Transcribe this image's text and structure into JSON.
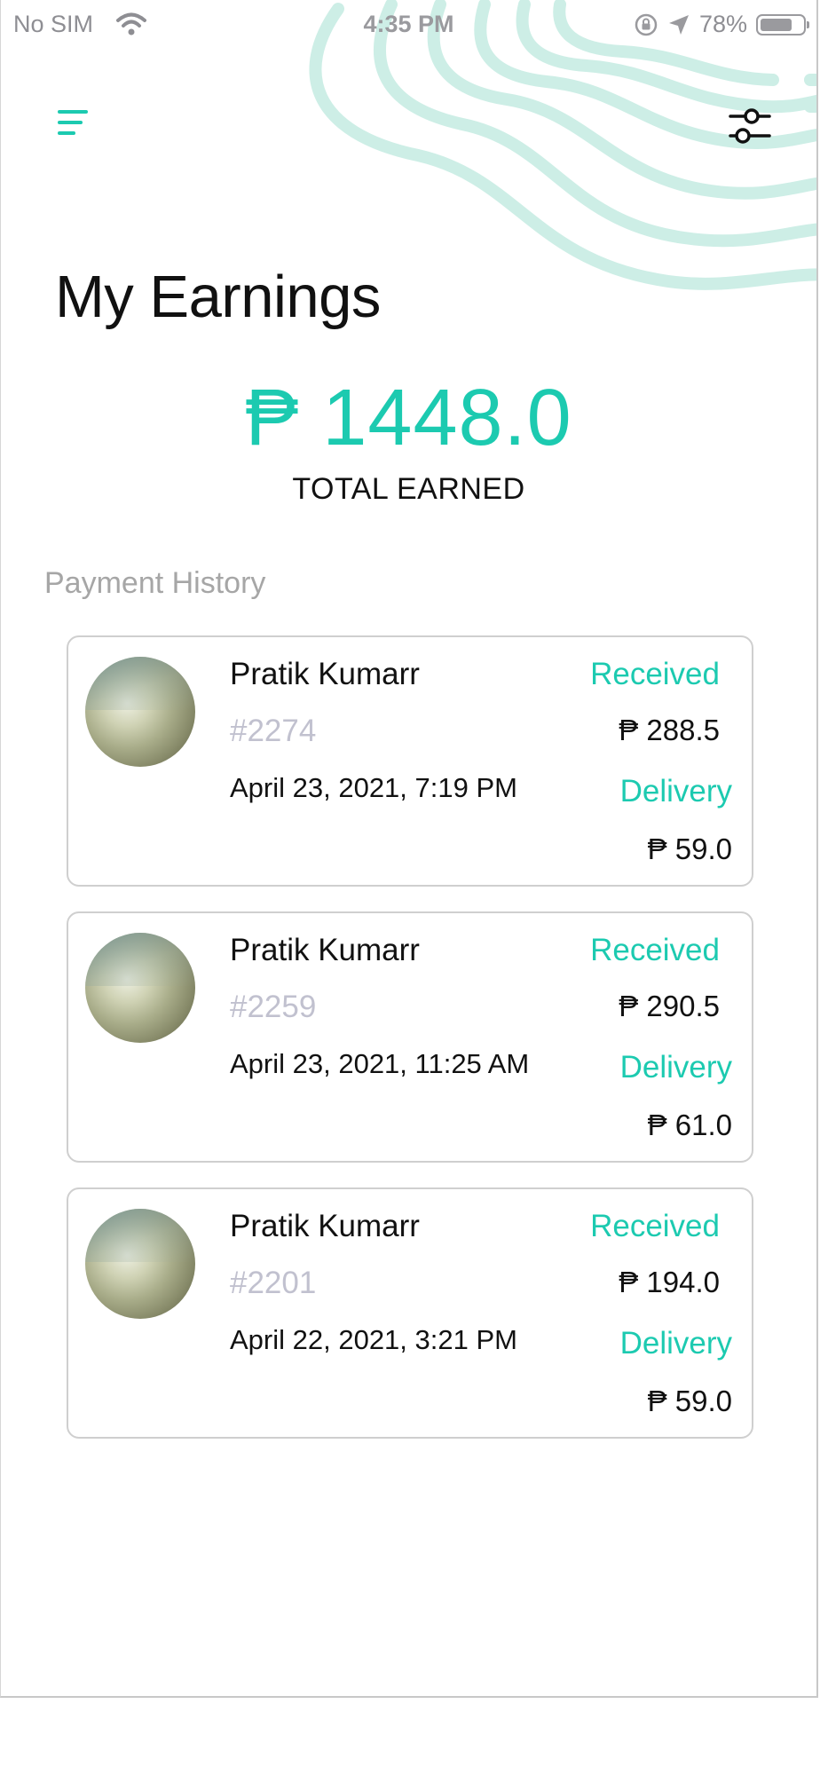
{
  "status_bar": {
    "carrier": "No SIM",
    "time": "4:35 PM",
    "battery": "78%",
    "battery_level": 0.78
  },
  "header": {
    "menu_icon": "menu-icon",
    "filter_icon": "sliders-icon",
    "accent_color": "#1ccab0"
  },
  "page": {
    "title": "My Earnings",
    "total_amount": "₱ 1448.0",
    "total_label": "TOTAL EARNED",
    "section_label": "Payment History"
  },
  "payments": [
    {
      "name": "Pratik Kumarr",
      "order_id": "#2274",
      "date": "April 23, 2021, 7:19 PM",
      "received_label": "Received",
      "received_amount": "₱ 288.5",
      "delivery_label": "Delivery",
      "delivery_amount": "₱ 59.0"
    },
    {
      "name": "Pratik Kumarr",
      "order_id": "#2259",
      "date": "April 23, 2021, 11:25 AM",
      "received_label": "Received",
      "received_amount": "₱ 290.5",
      "delivery_label": "Delivery",
      "delivery_amount": "₱ 61.0"
    },
    {
      "name": "Pratik Kumarr",
      "order_id": "#2201",
      "date": "April 22, 2021, 3:21 PM",
      "received_label": "Received",
      "received_amount": "₱ 194.0",
      "delivery_label": "Delivery",
      "delivery_amount": "₱ 59.0"
    }
  ]
}
